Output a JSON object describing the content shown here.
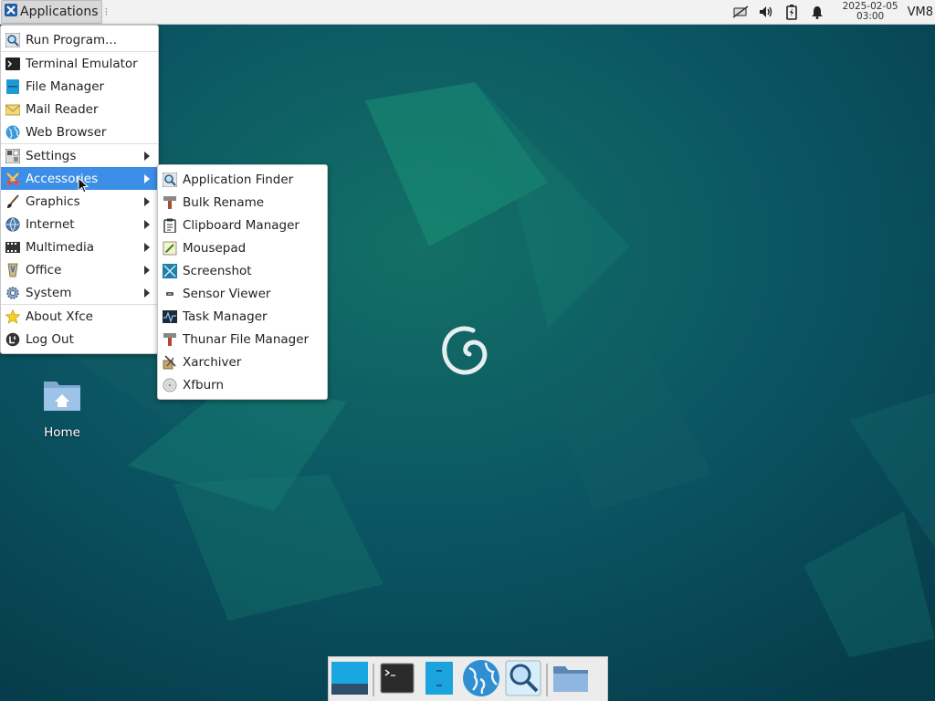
{
  "panel": {
    "app_menu_label": "Applications",
    "clock_date": "2025-02-05",
    "clock_time": "03:00",
    "host": "VM8",
    "tray_icons": [
      "network-icon",
      "volume-icon",
      "battery-icon",
      "notification-bell-icon"
    ]
  },
  "main_menu": {
    "items": [
      {
        "label": "Run Program...",
        "icon": "search-icon"
      },
      {
        "label": "Terminal Emulator",
        "icon": "terminal-icon"
      },
      {
        "label": "File Manager",
        "icon": "file-manager-icon"
      },
      {
        "label": "Mail Reader",
        "icon": "mail-icon"
      },
      {
        "label": "Web Browser",
        "icon": "globe-icon"
      },
      {
        "label": "Settings",
        "icon": "settings-icon",
        "submenu": true
      },
      {
        "label": "Accessories",
        "icon": "accessories-icon",
        "submenu": true,
        "active": true
      },
      {
        "label": "Graphics",
        "icon": "graphics-icon",
        "submenu": true
      },
      {
        "label": "Internet",
        "icon": "internet-icon",
        "submenu": true
      },
      {
        "label": "Multimedia",
        "icon": "multimedia-icon",
        "submenu": true
      },
      {
        "label": "Office",
        "icon": "office-icon",
        "submenu": true
      },
      {
        "label": "System",
        "icon": "system-icon",
        "submenu": true
      },
      {
        "label": "About Xfce",
        "icon": "star-icon"
      },
      {
        "label": "Log Out",
        "icon": "logout-icon"
      }
    ]
  },
  "accessories_menu": {
    "items": [
      {
        "label": "Application Finder",
        "icon": "app-finder-icon"
      },
      {
        "label": "Bulk Rename",
        "icon": "bulk-rename-icon"
      },
      {
        "label": "Clipboard Manager",
        "icon": "clipboard-icon"
      },
      {
        "label": "Mousepad",
        "icon": "text-editor-icon"
      },
      {
        "label": "Screenshot",
        "icon": "screenshot-icon"
      },
      {
        "label": "Sensor Viewer",
        "icon": "sensor-icon"
      },
      {
        "label": "Task Manager",
        "icon": "task-manager-icon"
      },
      {
        "label": "Thunar File Manager",
        "icon": "thunar-icon"
      },
      {
        "label": "Xarchiver",
        "icon": "archive-icon"
      },
      {
        "label": "Xfburn",
        "icon": "disc-icon"
      }
    ]
  },
  "desktop": {
    "home_label": "Home"
  },
  "dock": {
    "items": [
      "show-desktop-icon",
      "terminal-icon",
      "file-manager-icon",
      "web-browser-icon",
      "app-finder-icon",
      "folder-icon"
    ]
  },
  "colors": {
    "highlight": "#3d8ee6",
    "wallpaper_dark": "#08404e",
    "wallpaper_light": "#14806e"
  }
}
